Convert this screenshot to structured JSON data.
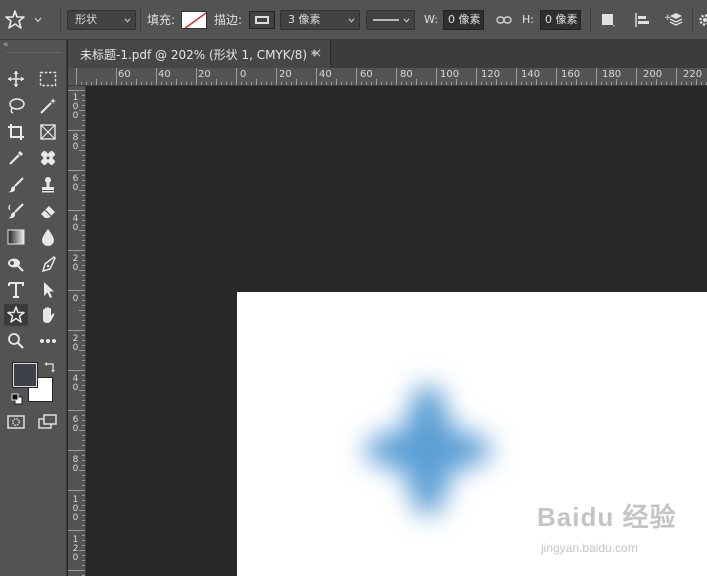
{
  "options_bar": {
    "shape_mode": "形状",
    "fill_label": "填充:",
    "stroke_label": "描边:",
    "stroke_width": "3 像素",
    "w_label": "W:",
    "w_value": "0 像素",
    "h_label": "H:",
    "h_value": "0 像素"
  },
  "tools_panel": {
    "collapse_glyph": "«",
    "tools": [
      "move-tool",
      "marquee-tool",
      "lasso-tool",
      "magic-wand-tool",
      "crop-tool",
      "frame-tool",
      "eyedropper-tool",
      "healing-brush-tool",
      "brush-tool",
      "clone-stamp-tool",
      "history-brush-tool",
      "eraser-tool",
      "gradient-tool",
      "blur-tool",
      "dodge-tool",
      "pen-tool",
      "type-tool",
      "path-selection-tool",
      "custom-shape-tool",
      "hand-tool",
      "zoom-tool",
      "more-tools",
      "quick-mask",
      "screen-mode"
    ],
    "active_tool": "custom-shape-tool",
    "foreground_color": "#3d3f4a",
    "background_color": "#ffffff"
  },
  "document": {
    "tab_title": "未标题-1.pdf @ 202% (形状 1, CMYK/8) *",
    "close_glyph": "×"
  },
  "rulers": {
    "horizontal_labels": [
      "60",
      "40",
      "20",
      "0",
      "20",
      "40",
      "60",
      "80",
      "100",
      "120",
      "140",
      "160",
      "180",
      "200",
      "220"
    ],
    "vertical_labels": [
      "100",
      "80",
      "60",
      "40",
      "20",
      "0",
      "20",
      "40",
      "60",
      "80",
      "100",
      "120"
    ]
  },
  "canvas": {
    "shape_color": "#5b9fd4",
    "pasteboard_color": "#282828",
    "artboard_color": "#ffffff"
  },
  "watermark": {
    "logo": "Baidu 经验",
    "url": "jingyan.baidu.com"
  }
}
